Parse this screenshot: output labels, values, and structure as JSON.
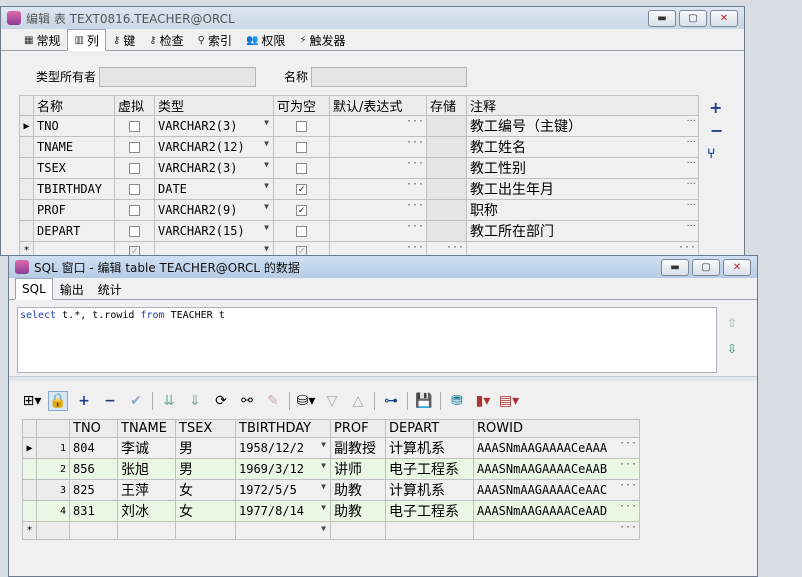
{
  "top_window": {
    "title": "编辑 表 TEXT0816.TEACHER@ORCL",
    "tabs": [
      {
        "label": "常规",
        "icon": "table-icon"
      },
      {
        "label": "列",
        "icon": "column-icon",
        "active": true
      },
      {
        "label": "键",
        "icon": "key-icon"
      },
      {
        "label": "检查",
        "icon": "check-icon"
      },
      {
        "label": "索引",
        "icon": "index-icon"
      },
      {
        "label": "权限",
        "icon": "users-icon"
      },
      {
        "label": "触发器",
        "icon": "trigger-icon"
      }
    ],
    "owner_label": "类型所有者",
    "owner_value": "",
    "name_label": "名称",
    "name_value": "",
    "columns_header": [
      "名称",
      "虚拟",
      "类型",
      "可为空",
      "默认/表达式",
      "存储",
      "注释"
    ],
    "rows": [
      {
        "name": "TNO",
        "virtual": false,
        "type": "VARCHAR2(3)",
        "nullable": false,
        "comment": "教工编号（主键）"
      },
      {
        "name": "TNAME",
        "virtual": false,
        "type": "VARCHAR2(12)",
        "nullable": false,
        "comment": "教工姓名"
      },
      {
        "name": "TSEX",
        "virtual": false,
        "type": "VARCHAR2(3)",
        "nullable": false,
        "comment": "教工性别"
      },
      {
        "name": "TBIRTHDAY",
        "virtual": false,
        "type": "DATE",
        "nullable": true,
        "comment": "教工出生年月"
      },
      {
        "name": "PROF",
        "virtual": false,
        "type": "VARCHAR2(9)",
        "nullable": true,
        "comment": "职称"
      },
      {
        "name": "DEPART",
        "virtual": false,
        "type": "VARCHAR2(15)",
        "nullable": false,
        "comment": "教工所在部门"
      }
    ],
    "side_buttons": [
      "+",
      "−",
      "⑂"
    ]
  },
  "sql_window": {
    "title": "SQL 窗口 - 编辑 table TEACHER@ORCL 的数据",
    "tabs": [
      "SQL",
      "输出",
      "统计"
    ],
    "sql_keywords": {
      "select": "select",
      "from": "from"
    },
    "sql_cols": "t.*, t.rowid",
    "sql_table": "TEACHER t",
    "result_headers": [
      "TNO",
      "TNAME",
      "TSEX",
      "TBIRTHDAY",
      "PROF",
      "DEPART",
      "ROWID"
    ],
    "result_rows": [
      {
        "num": "1",
        "TNO": "804",
        "TNAME": "李诚",
        "TSEX": "男",
        "TBIRTHDAY": "1958/12/2",
        "PROF": "副教授",
        "DEPART": "计算机系",
        "ROWID": "AAASNmAAGAAAACeAAA"
      },
      {
        "num": "2",
        "TNO": "856",
        "TNAME": "张旭",
        "TSEX": "男",
        "TBIRTHDAY": "1969/3/12",
        "PROF": "讲师",
        "DEPART": "电子工程系",
        "ROWID": "AAASNmAAGAAAACeAAB"
      },
      {
        "num": "3",
        "TNO": "825",
        "TNAME": "王萍",
        "TSEX": "女",
        "TBIRTHDAY": "1972/5/5",
        "PROF": "助教",
        "DEPART": "计算机系",
        "ROWID": "AAASNmAAGAAAACeAAC"
      },
      {
        "num": "4",
        "TNO": "831",
        "TNAME": "刘冰",
        "TSEX": "女",
        "TBIRTHDAY": "1977/8/14",
        "PROF": "助教",
        "DEPART": "电子工程系",
        "ROWID": "AAASNmAAGAAAACeAAD"
      }
    ],
    "new_row_marker": "*"
  },
  "window_buttons": {
    "minimize": "▬",
    "maximize": "▢",
    "close": "✕"
  }
}
